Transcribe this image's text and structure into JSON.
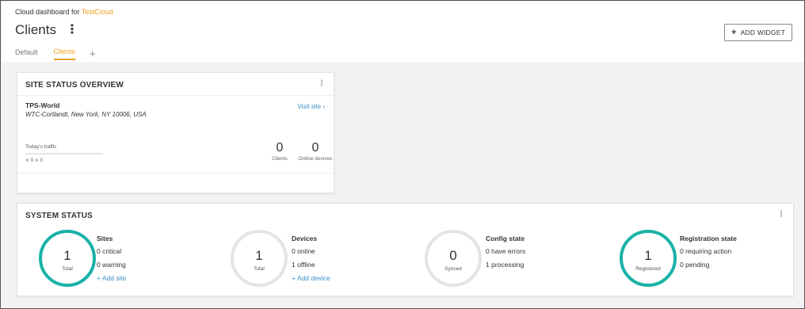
{
  "header": {
    "subtitle_prefix": "Cloud dashboard for ",
    "subtitle_brand": "TestCloud",
    "title": "Clients",
    "menu_icon": "kebab-menu-icon",
    "tabs": [
      {
        "label": "Default",
        "active": false
      },
      {
        "label": "Clients",
        "active": true
      }
    ],
    "add_tab_icon": "plus-icon",
    "add_widget_label": "ADD WIDGET"
  },
  "site_status": {
    "title": "SITE STATUS OVERVIEW",
    "site_name": "TPS-World",
    "address": "WTC-Cortlandt, New York, NY 10006, USA",
    "visit_link": "Visit site ›",
    "traffic_label": "Today's traffic",
    "traffic_values": "∨ 0 ∧ 0",
    "clients_count": "0",
    "clients_label": "Clients",
    "devices_count": "0",
    "devices_label": "Online devices"
  },
  "system_status": {
    "title": "SYSTEM STATUS",
    "sections": [
      {
        "gauge_value": "1",
        "gauge_label": "Total",
        "gauge_color": "#1ab2a8",
        "title": "Sites",
        "lines": [
          "0 critical",
          "0 warning"
        ],
        "link": "+ Add site"
      },
      {
        "gauge_value": "1",
        "gauge_label": "Total",
        "gauge_color": "#e4e4e4",
        "title": "Devices",
        "lines": [
          "0 online",
          "1 offline"
        ],
        "link": "+ Add device"
      },
      {
        "gauge_value": "0",
        "gauge_label": "Synced",
        "gauge_color": "#e4e4e4",
        "title": "Config state",
        "lines": [
          "0 have errors",
          "1 processing"
        ],
        "link": ""
      },
      {
        "gauge_value": "1",
        "gauge_label": "Registered",
        "gauge_color": "#1ab2a8",
        "title": "Registration state",
        "lines": [
          "0 requiring action",
          "0 pending"
        ],
        "link": ""
      }
    ]
  },
  "colors": {
    "accent_orange": "#f0a020",
    "teal": "#1ab2a8",
    "link_blue": "#3a8fc8"
  }
}
